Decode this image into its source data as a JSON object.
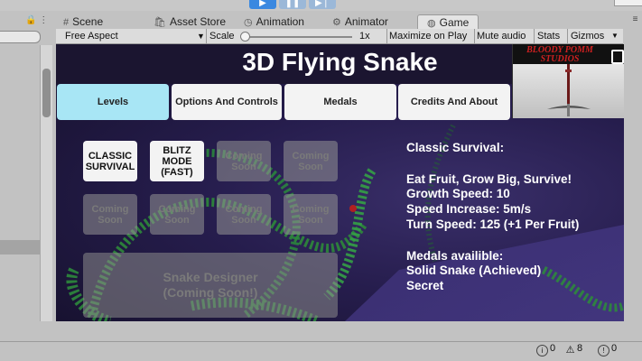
{
  "editor": {
    "play_controls": [
      {
        "name": "play",
        "glyph": "▶"
      },
      {
        "name": "pause",
        "glyph": "❚❚"
      },
      {
        "name": "step",
        "glyph": "▶❘"
      }
    ],
    "tabs": [
      {
        "label": "Scene",
        "icon": "grid-icon",
        "glyph": "#"
      },
      {
        "label": "Asset Store",
        "icon": "store-icon",
        "glyph": "🛍"
      },
      {
        "label": "Animation",
        "icon": "animation-icon",
        "glyph": "◷"
      },
      {
        "label": "Animator",
        "icon": "animator-icon",
        "glyph": "⚙"
      },
      {
        "label": "Game",
        "icon": "game-icon",
        "glyph": "◍",
        "active": true
      }
    ],
    "toolbar": {
      "aspect": "Free Aspect",
      "scale_label": "Scale",
      "scale_value": "1x",
      "maximize": "Maximize on Play",
      "mute": "Mute audio",
      "stats": "Stats",
      "gizmos": "Gizmos"
    },
    "console": {
      "messages": "0",
      "warnings": "8",
      "errors": "0"
    }
  },
  "game": {
    "title": "3D Flying Snake",
    "logo_text_line1": "BLOODY POMM",
    "logo_text_line2": "STUDIOS",
    "menu_tabs": [
      {
        "label": "Levels",
        "active": true
      },
      {
        "label": "Options And Controls",
        "active": false
      },
      {
        "label": "Medals",
        "active": false
      },
      {
        "label": "Credits And About",
        "active": false
      }
    ],
    "levels": [
      {
        "line1": "CLASSIC",
        "line2": "SURVIVAL",
        "line3": "",
        "enabled": true
      },
      {
        "line1": "BLITZ",
        "line2": "MODE",
        "line3": "(FAST)",
        "enabled": true
      },
      {
        "line1": "Coming",
        "line2": "Soon",
        "line3": "",
        "enabled": false
      },
      {
        "line1": "Coming",
        "line2": "Soon",
        "line3": "",
        "enabled": false
      },
      {
        "line1": "Coming",
        "line2": "Soon",
        "line3": "",
        "enabled": false
      },
      {
        "line1": "Coming",
        "line2": "Soon",
        "line3": "",
        "enabled": false
      },
      {
        "line1": "Coming",
        "line2": "Soon",
        "line3": "",
        "enabled": false
      },
      {
        "line1": "Coming",
        "line2": "Soon",
        "line3": "",
        "enabled": false
      }
    ],
    "designer": {
      "line1": "Snake Designer",
      "line2": "(Coming Soon!)"
    },
    "info": {
      "mode_title": "Classic Survival:",
      "tagline": "Eat Fruit, Grow Big, Survive!",
      "growth": "Growth Speed:  10",
      "speed": "Speed Increase: 5m/s",
      "turn": "Turn Speed: 125 (+1 Per Fruit)",
      "medals_title": "Medals availible:",
      "medal_1": "Solid Snake (Achieved)",
      "medal_2": "Secret"
    }
  }
}
